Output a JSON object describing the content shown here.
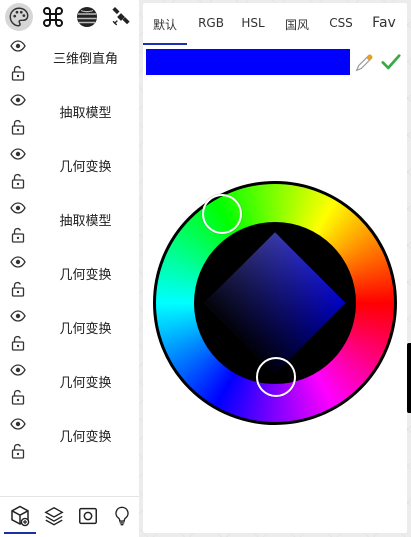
{
  "toolbar": {
    "buttons": [
      {
        "icon": "palette-icon",
        "active": true
      },
      {
        "icon": "command-icon",
        "active": false
      },
      {
        "icon": "texture-sphere-icon",
        "active": false
      },
      {
        "icon": "satellite-icon",
        "active": false
      }
    ]
  },
  "objects": [
    {
      "name": "三维倒直角",
      "visible_icon": "eye-icon",
      "lock_icon": "unlock-icon"
    },
    {
      "name": "抽取模型",
      "visible_icon": "eye-icon",
      "lock_icon": "unlock-icon"
    },
    {
      "name": "几何变换",
      "visible_icon": "eye-icon",
      "lock_icon": "unlock-icon"
    },
    {
      "name": "抽取模型",
      "visible_icon": "eye-icon",
      "lock_icon": "unlock-icon"
    },
    {
      "name": "几何变换",
      "visible_icon": "eye-icon",
      "lock_icon": "unlock-icon"
    },
    {
      "name": "几何变换",
      "visible_icon": "eye-icon",
      "lock_icon": "unlock-icon"
    },
    {
      "name": "几何变换",
      "visible_icon": "eye-icon",
      "lock_icon": "unlock-icon"
    },
    {
      "name": "几何变换",
      "visible_icon": "eye-icon",
      "lock_icon": "unlock-icon"
    }
  ],
  "bottom_toolbar": {
    "buttons": [
      "cube-tool-icon",
      "layers-icon",
      "camera-frame-icon",
      "lightbulb-icon"
    ],
    "active_index": 0
  },
  "color_picker": {
    "tabs": [
      "默认",
      "RGB",
      "HSL",
      "国风",
      "CSS",
      "Fav"
    ],
    "active_tab": 0,
    "current_color": "#0000ff",
    "accent_color": "#1e2fb0",
    "confirm_color": "#3aa845"
  }
}
